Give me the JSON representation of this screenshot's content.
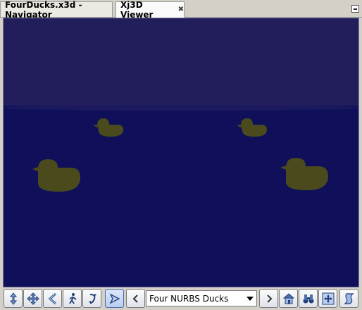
{
  "tabs": [
    {
      "label": "FourDucks.x3d - Navigator",
      "active": false
    },
    {
      "label": "Xj3D Viewer",
      "active": true,
      "close_icon": "close-x-icon"
    }
  ],
  "viewer": {
    "scene_colors": {
      "sky": "#221e5c",
      "water": "#10105a",
      "duck": "#4a4a1c"
    }
  },
  "toolbar": {
    "viewpoint_value": "Four NURBS Ducks",
    "buttons": [
      {
        "icon": "pan-arrows-icon"
      },
      {
        "icon": "move-arrows-icon"
      },
      {
        "icon": "back-arrow-icon"
      },
      {
        "icon": "walk-icon"
      },
      {
        "icon": "tilt-icon"
      },
      {
        "icon": "fly-icon",
        "active": true
      },
      {
        "icon": "previous-viewpoint-icon"
      },
      {
        "icon": "next-viewpoint-icon"
      },
      {
        "icon": "home-icon"
      },
      {
        "icon": "binoculars-icon"
      },
      {
        "icon": "fit-icon"
      },
      {
        "icon": "examine-icon"
      }
    ]
  }
}
